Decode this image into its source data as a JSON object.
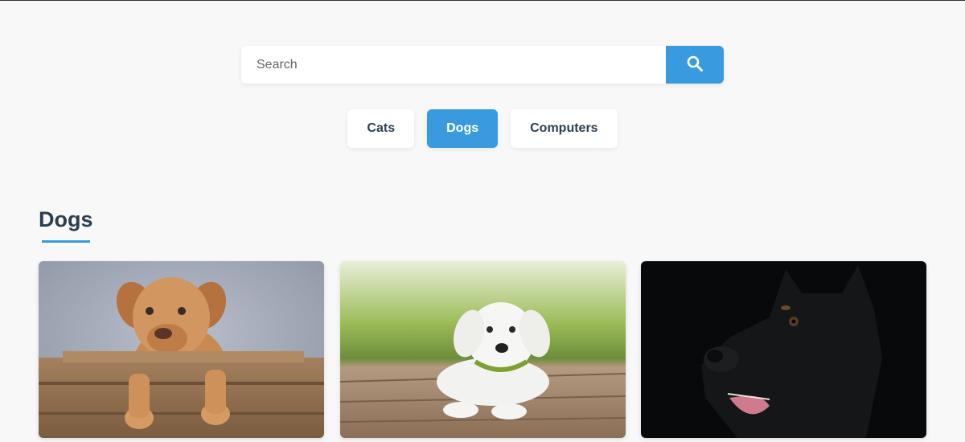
{
  "search": {
    "placeholder": "Search",
    "value": "",
    "button_icon": "search-icon"
  },
  "tabs": [
    {
      "label": "Cats",
      "active": false
    },
    {
      "label": "Dogs",
      "active": true
    },
    {
      "label": "Computers",
      "active": false
    }
  ],
  "section": {
    "title": "Dogs"
  },
  "gallery": [
    {
      "subject": "brown puppy in wooden crate"
    },
    {
      "subject": "white puppy lying on wooden deck"
    },
    {
      "subject": "black dog head on dark background"
    }
  ],
  "colors": {
    "accent": "#3a9ae0",
    "heading": "#2c3e50",
    "background": "#f8f8f8"
  }
}
